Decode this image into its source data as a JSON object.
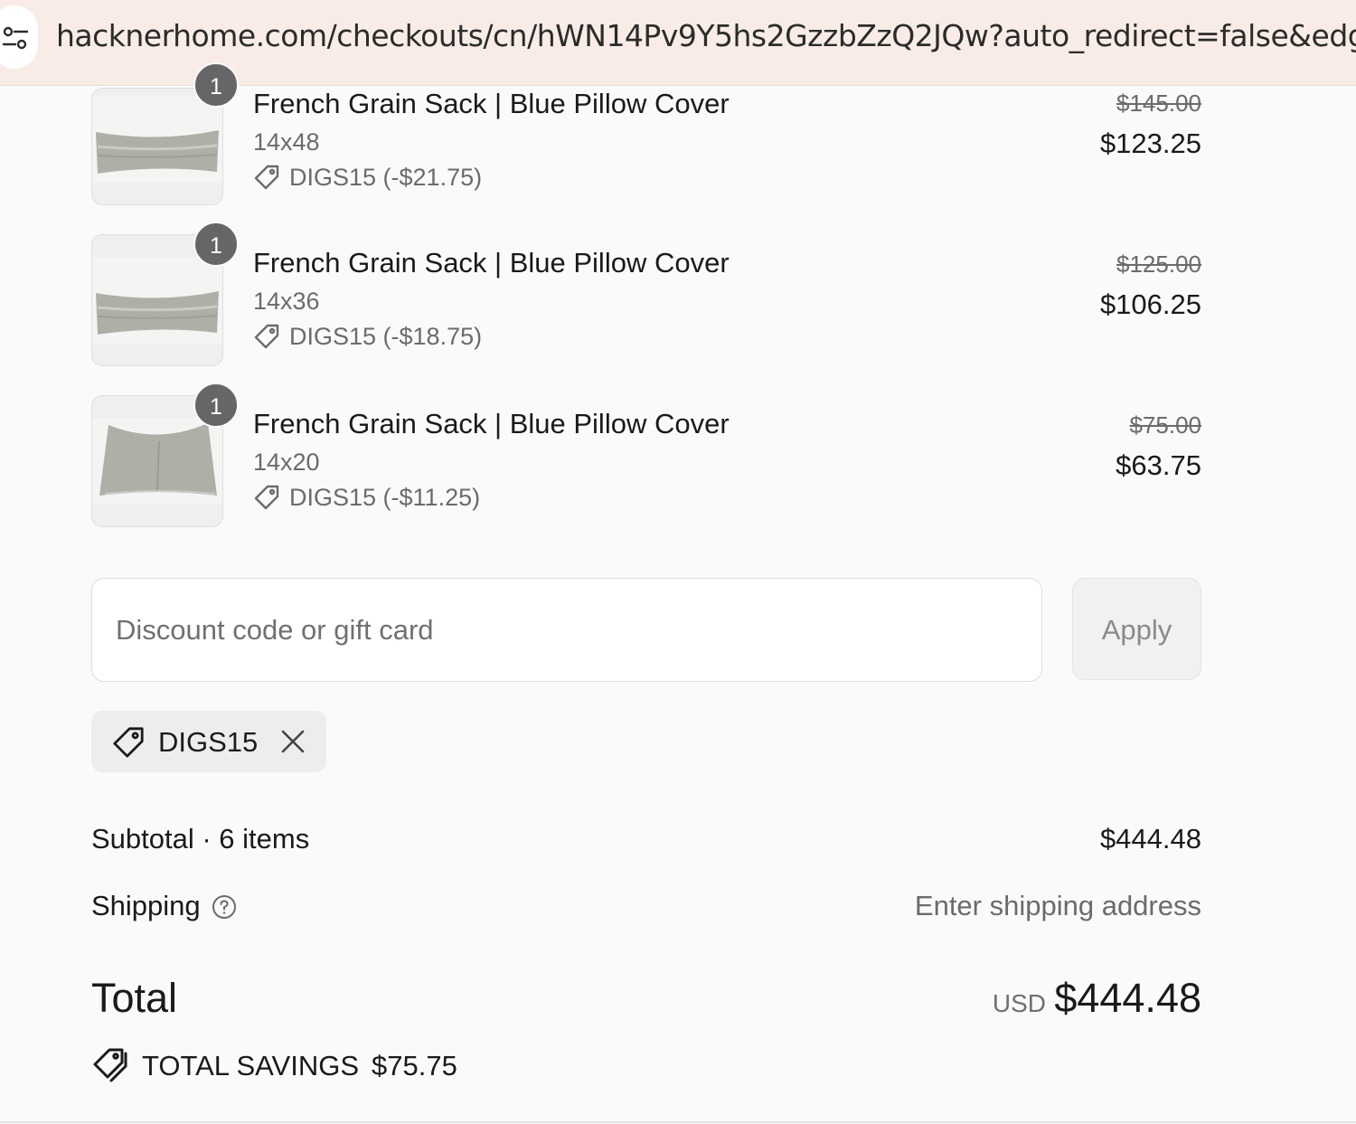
{
  "browser": {
    "url": "hacknerhome.com/checkouts/cn/hWN14Pv9Y5hs2GzzbZzQ2JQw?auto_redirect=false&edge_redirect=",
    "site_icon": "tune-settings-icon"
  },
  "items": [
    {
      "name": "French Grain Sack | Blue Pillow Cover",
      "variant": "14x48",
      "discount": "DIGS15 (-$21.75)",
      "original_price": "$145.00",
      "price": "$123.25",
      "quantity": "1"
    },
    {
      "name": "French Grain Sack | Blue Pillow Cover",
      "variant": "14x36",
      "discount": "DIGS15 (-$18.75)",
      "original_price": "$125.00",
      "price": "$106.25",
      "quantity": "1"
    },
    {
      "name": "French Grain Sack | Blue Pillow Cover",
      "variant": "14x20",
      "discount": "DIGS15 (-$11.25)",
      "original_price": "$75.00",
      "price": "$63.75",
      "quantity": "1"
    }
  ],
  "discount_form": {
    "placeholder": "Discount code or gift card",
    "value": "",
    "apply_label": "Apply"
  },
  "applied_code": {
    "code": "DIGS15",
    "tag_icon": "tag-icon",
    "remove_icon": "close-icon"
  },
  "summary": {
    "subtotal_label": "Subtotal · 6 items",
    "subtotal_value": "$444.48",
    "shipping_label": "Shipping",
    "shipping_value": "Enter shipping address",
    "total_label": "Total",
    "currency": "USD",
    "total_value": "$444.48",
    "savings_label": "TOTAL SAVINGS",
    "savings_value": "$75.75"
  },
  "colors": {
    "url_bar_bg": "#f9ece6",
    "page_bg": "#fafafa",
    "qty_badge": "#666666",
    "muted_text": "#6b6b6b"
  }
}
